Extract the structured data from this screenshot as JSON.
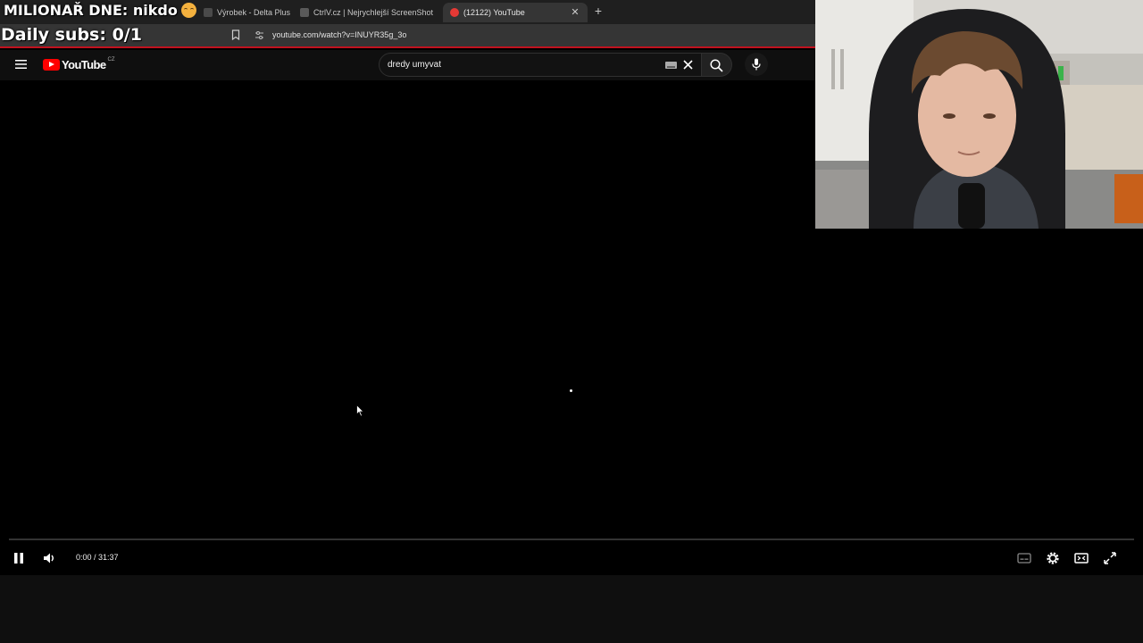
{
  "overlay": {
    "title": "MILIONAŘ DNE: nikdo",
    "daily_subs": "Daily subs: 0/1"
  },
  "browser": {
    "tabs": [
      {
        "label": "Výrobek - Delta Plus",
        "icon": "tab-favicon",
        "active": false
      },
      {
        "label": "CtrlV.cz | Nejrychlejší ScreenShot a P",
        "icon": "tab-favicon",
        "active": false
      },
      {
        "label": "(12122) YouTube",
        "icon": "youtube-favicon",
        "active": true
      }
    ],
    "url": "youtube.com/watch?v=INUYR35g_3o"
  },
  "youtube": {
    "logo_text": "YouTube",
    "country_code": "CZ",
    "search_value": "dredy umyvat"
  },
  "player": {
    "time_display": "0:00 / 31:37",
    "progress_fraction": 0
  },
  "colors": {
    "youtube_red": "#ff0000",
    "accent_red_line": "#c1121f"
  }
}
